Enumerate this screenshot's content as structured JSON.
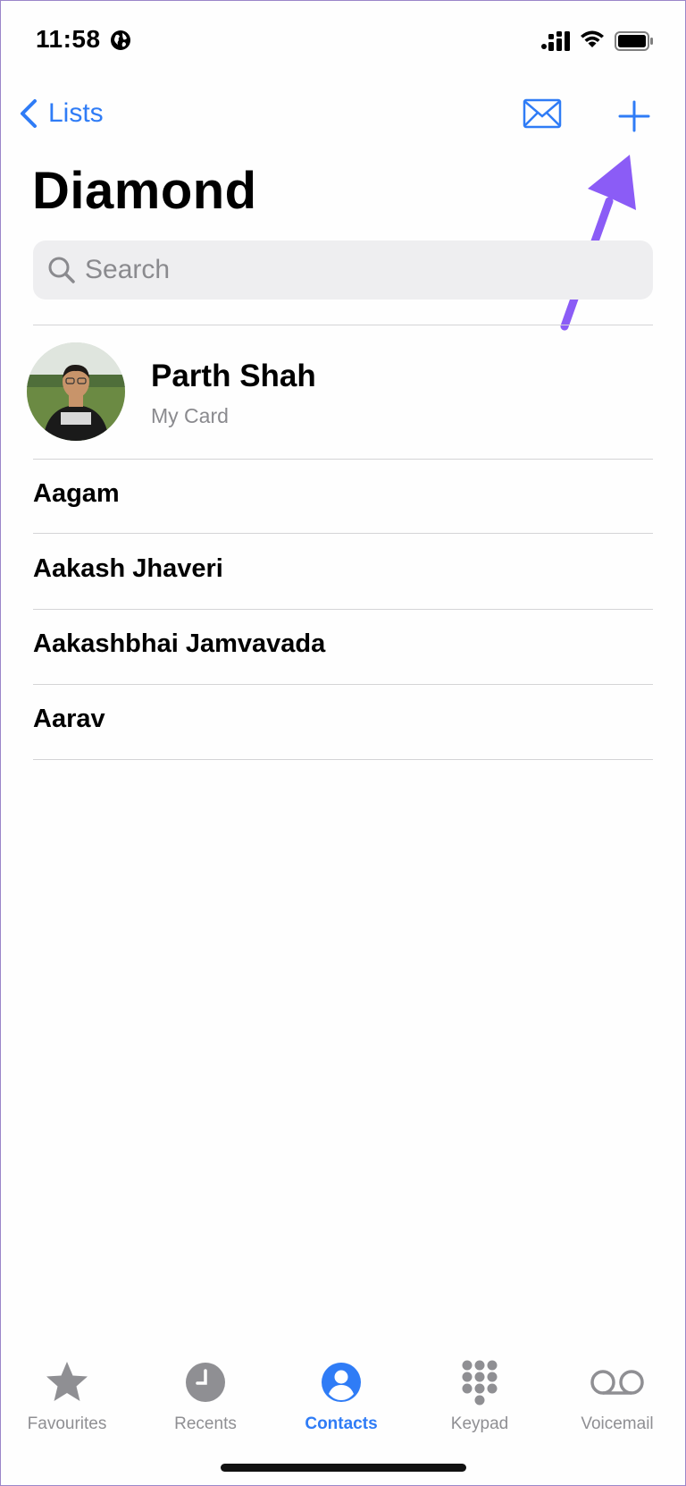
{
  "status": {
    "time": "11:58"
  },
  "nav": {
    "back_label": "Lists"
  },
  "page": {
    "title": "Diamond"
  },
  "search": {
    "placeholder": "Search"
  },
  "my_card": {
    "name": "Parth Shah",
    "subtitle": "My Card"
  },
  "contacts": [
    "Aagam",
    "Aakash Jhaveri",
    "Aakashbhai Jamvavada",
    "Aarav"
  ],
  "tabs": [
    {
      "label": "Favourites",
      "icon": "star-icon"
    },
    {
      "label": "Recents",
      "icon": "clock-icon"
    },
    {
      "label": "Contacts",
      "icon": "person-circle-icon",
      "active": true
    },
    {
      "label": "Keypad",
      "icon": "keypad-icon"
    },
    {
      "label": "Voicemail",
      "icon": "voicemail-icon"
    }
  ],
  "colors": {
    "accent": "#2f7cf6",
    "annotation_arrow": "#8b5cf6",
    "inactive": "#8f8f93"
  }
}
